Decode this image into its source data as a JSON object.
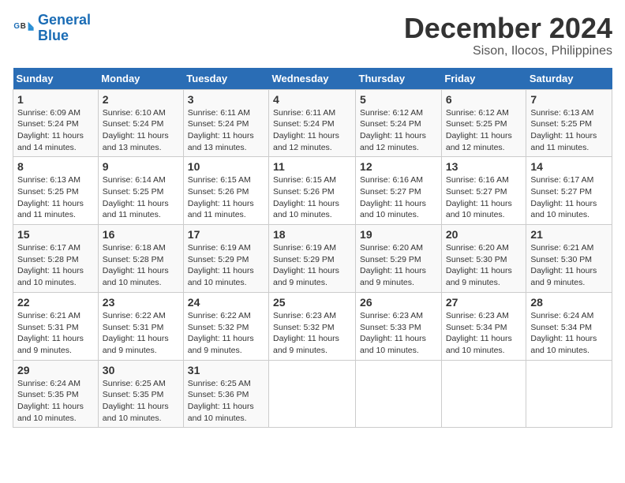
{
  "logo": {
    "line1": "General",
    "line2": "Blue"
  },
  "title": "December 2024",
  "location": "Sison, Ilocos, Philippines",
  "days_of_week": [
    "Sunday",
    "Monday",
    "Tuesday",
    "Wednesday",
    "Thursday",
    "Friday",
    "Saturday"
  ],
  "weeks": [
    [
      {
        "day": "1",
        "sunrise": "Sunrise: 6:09 AM",
        "sunset": "Sunset: 5:24 PM",
        "daylight": "Daylight: 11 hours and 14 minutes."
      },
      {
        "day": "2",
        "sunrise": "Sunrise: 6:10 AM",
        "sunset": "Sunset: 5:24 PM",
        "daylight": "Daylight: 11 hours and 13 minutes."
      },
      {
        "day": "3",
        "sunrise": "Sunrise: 6:11 AM",
        "sunset": "Sunset: 5:24 PM",
        "daylight": "Daylight: 11 hours and 13 minutes."
      },
      {
        "day": "4",
        "sunrise": "Sunrise: 6:11 AM",
        "sunset": "Sunset: 5:24 PM",
        "daylight": "Daylight: 11 hours and 12 minutes."
      },
      {
        "day": "5",
        "sunrise": "Sunrise: 6:12 AM",
        "sunset": "Sunset: 5:24 PM",
        "daylight": "Daylight: 11 hours and 12 minutes."
      },
      {
        "day": "6",
        "sunrise": "Sunrise: 6:12 AM",
        "sunset": "Sunset: 5:25 PM",
        "daylight": "Daylight: 11 hours and 12 minutes."
      },
      {
        "day": "7",
        "sunrise": "Sunrise: 6:13 AM",
        "sunset": "Sunset: 5:25 PM",
        "daylight": "Daylight: 11 hours and 11 minutes."
      }
    ],
    [
      {
        "day": "8",
        "sunrise": "Sunrise: 6:13 AM",
        "sunset": "Sunset: 5:25 PM",
        "daylight": "Daylight: 11 hours and 11 minutes."
      },
      {
        "day": "9",
        "sunrise": "Sunrise: 6:14 AM",
        "sunset": "Sunset: 5:25 PM",
        "daylight": "Daylight: 11 hours and 11 minutes."
      },
      {
        "day": "10",
        "sunrise": "Sunrise: 6:15 AM",
        "sunset": "Sunset: 5:26 PM",
        "daylight": "Daylight: 11 hours and 11 minutes."
      },
      {
        "day": "11",
        "sunrise": "Sunrise: 6:15 AM",
        "sunset": "Sunset: 5:26 PM",
        "daylight": "Daylight: 11 hours and 10 minutes."
      },
      {
        "day": "12",
        "sunrise": "Sunrise: 6:16 AM",
        "sunset": "Sunset: 5:27 PM",
        "daylight": "Daylight: 11 hours and 10 minutes."
      },
      {
        "day": "13",
        "sunrise": "Sunrise: 6:16 AM",
        "sunset": "Sunset: 5:27 PM",
        "daylight": "Daylight: 11 hours and 10 minutes."
      },
      {
        "day": "14",
        "sunrise": "Sunrise: 6:17 AM",
        "sunset": "Sunset: 5:27 PM",
        "daylight": "Daylight: 11 hours and 10 minutes."
      }
    ],
    [
      {
        "day": "15",
        "sunrise": "Sunrise: 6:17 AM",
        "sunset": "Sunset: 5:28 PM",
        "daylight": "Daylight: 11 hours and 10 minutes."
      },
      {
        "day": "16",
        "sunrise": "Sunrise: 6:18 AM",
        "sunset": "Sunset: 5:28 PM",
        "daylight": "Daylight: 11 hours and 10 minutes."
      },
      {
        "day": "17",
        "sunrise": "Sunrise: 6:19 AM",
        "sunset": "Sunset: 5:29 PM",
        "daylight": "Daylight: 11 hours and 10 minutes."
      },
      {
        "day": "18",
        "sunrise": "Sunrise: 6:19 AM",
        "sunset": "Sunset: 5:29 PM",
        "daylight": "Daylight: 11 hours and 9 minutes."
      },
      {
        "day": "19",
        "sunrise": "Sunrise: 6:20 AM",
        "sunset": "Sunset: 5:29 PM",
        "daylight": "Daylight: 11 hours and 9 minutes."
      },
      {
        "day": "20",
        "sunrise": "Sunrise: 6:20 AM",
        "sunset": "Sunset: 5:30 PM",
        "daylight": "Daylight: 11 hours and 9 minutes."
      },
      {
        "day": "21",
        "sunrise": "Sunrise: 6:21 AM",
        "sunset": "Sunset: 5:30 PM",
        "daylight": "Daylight: 11 hours and 9 minutes."
      }
    ],
    [
      {
        "day": "22",
        "sunrise": "Sunrise: 6:21 AM",
        "sunset": "Sunset: 5:31 PM",
        "daylight": "Daylight: 11 hours and 9 minutes."
      },
      {
        "day": "23",
        "sunrise": "Sunrise: 6:22 AM",
        "sunset": "Sunset: 5:31 PM",
        "daylight": "Daylight: 11 hours and 9 minutes."
      },
      {
        "day": "24",
        "sunrise": "Sunrise: 6:22 AM",
        "sunset": "Sunset: 5:32 PM",
        "daylight": "Daylight: 11 hours and 9 minutes."
      },
      {
        "day": "25",
        "sunrise": "Sunrise: 6:23 AM",
        "sunset": "Sunset: 5:32 PM",
        "daylight": "Daylight: 11 hours and 9 minutes."
      },
      {
        "day": "26",
        "sunrise": "Sunrise: 6:23 AM",
        "sunset": "Sunset: 5:33 PM",
        "daylight": "Daylight: 11 hours and 10 minutes."
      },
      {
        "day": "27",
        "sunrise": "Sunrise: 6:23 AM",
        "sunset": "Sunset: 5:34 PM",
        "daylight": "Daylight: 11 hours and 10 minutes."
      },
      {
        "day": "28",
        "sunrise": "Sunrise: 6:24 AM",
        "sunset": "Sunset: 5:34 PM",
        "daylight": "Daylight: 11 hours and 10 minutes."
      }
    ],
    [
      {
        "day": "29",
        "sunrise": "Sunrise: 6:24 AM",
        "sunset": "Sunset: 5:35 PM",
        "daylight": "Daylight: 11 hours and 10 minutes."
      },
      {
        "day": "30",
        "sunrise": "Sunrise: 6:25 AM",
        "sunset": "Sunset: 5:35 PM",
        "daylight": "Daylight: 11 hours and 10 minutes."
      },
      {
        "day": "31",
        "sunrise": "Sunrise: 6:25 AM",
        "sunset": "Sunset: 5:36 PM",
        "daylight": "Daylight: 11 hours and 10 minutes."
      },
      null,
      null,
      null,
      null
    ]
  ]
}
